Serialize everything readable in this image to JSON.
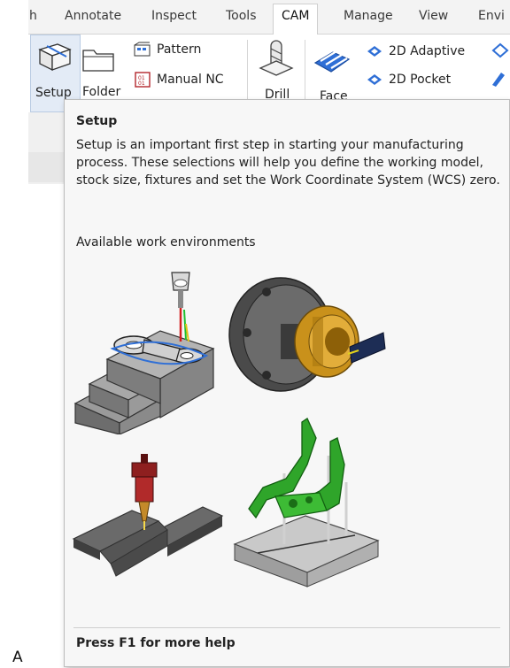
{
  "ribbon": {
    "tabs": [
      {
        "label": "h",
        "active": false
      },
      {
        "label": "Annotate",
        "active": false
      },
      {
        "label": "Inspect",
        "active": false
      },
      {
        "label": "Tools",
        "active": false
      },
      {
        "label": "CAM",
        "active": true
      },
      {
        "label": "Manage",
        "active": false
      },
      {
        "label": "View",
        "active": false
      },
      {
        "label": "Envi",
        "active": false
      }
    ],
    "buttons": {
      "setup": "Setup",
      "folder": "Folder",
      "pattern": "Pattern",
      "manual_nc": "Manual NC",
      "drill": "Drill",
      "face": "Face",
      "adaptive_2d": "2D Adaptive",
      "pocket_2d": "2D Pocket"
    }
  },
  "tooltip": {
    "title": "Setup",
    "description": "Setup is an important first step in starting your manufacturing process. These selections will help you define the working model, stock size, fixtures and set the Work Coordinate System (WCS) zero.",
    "subheading": "Available work environments",
    "footer": "Press F1 for more help",
    "environments": [
      "milling-environment",
      "turning-environment",
      "cutting-environment",
      "additive-environment"
    ]
  },
  "corner_label": "A",
  "colors": {
    "accent_blue": "#2f6fd6",
    "tooltip_bg": "#f7f7f7",
    "lathe_gold": "#c9911b",
    "additive_green": "#2fa52a",
    "cutter_red": "#8e1f1f"
  }
}
